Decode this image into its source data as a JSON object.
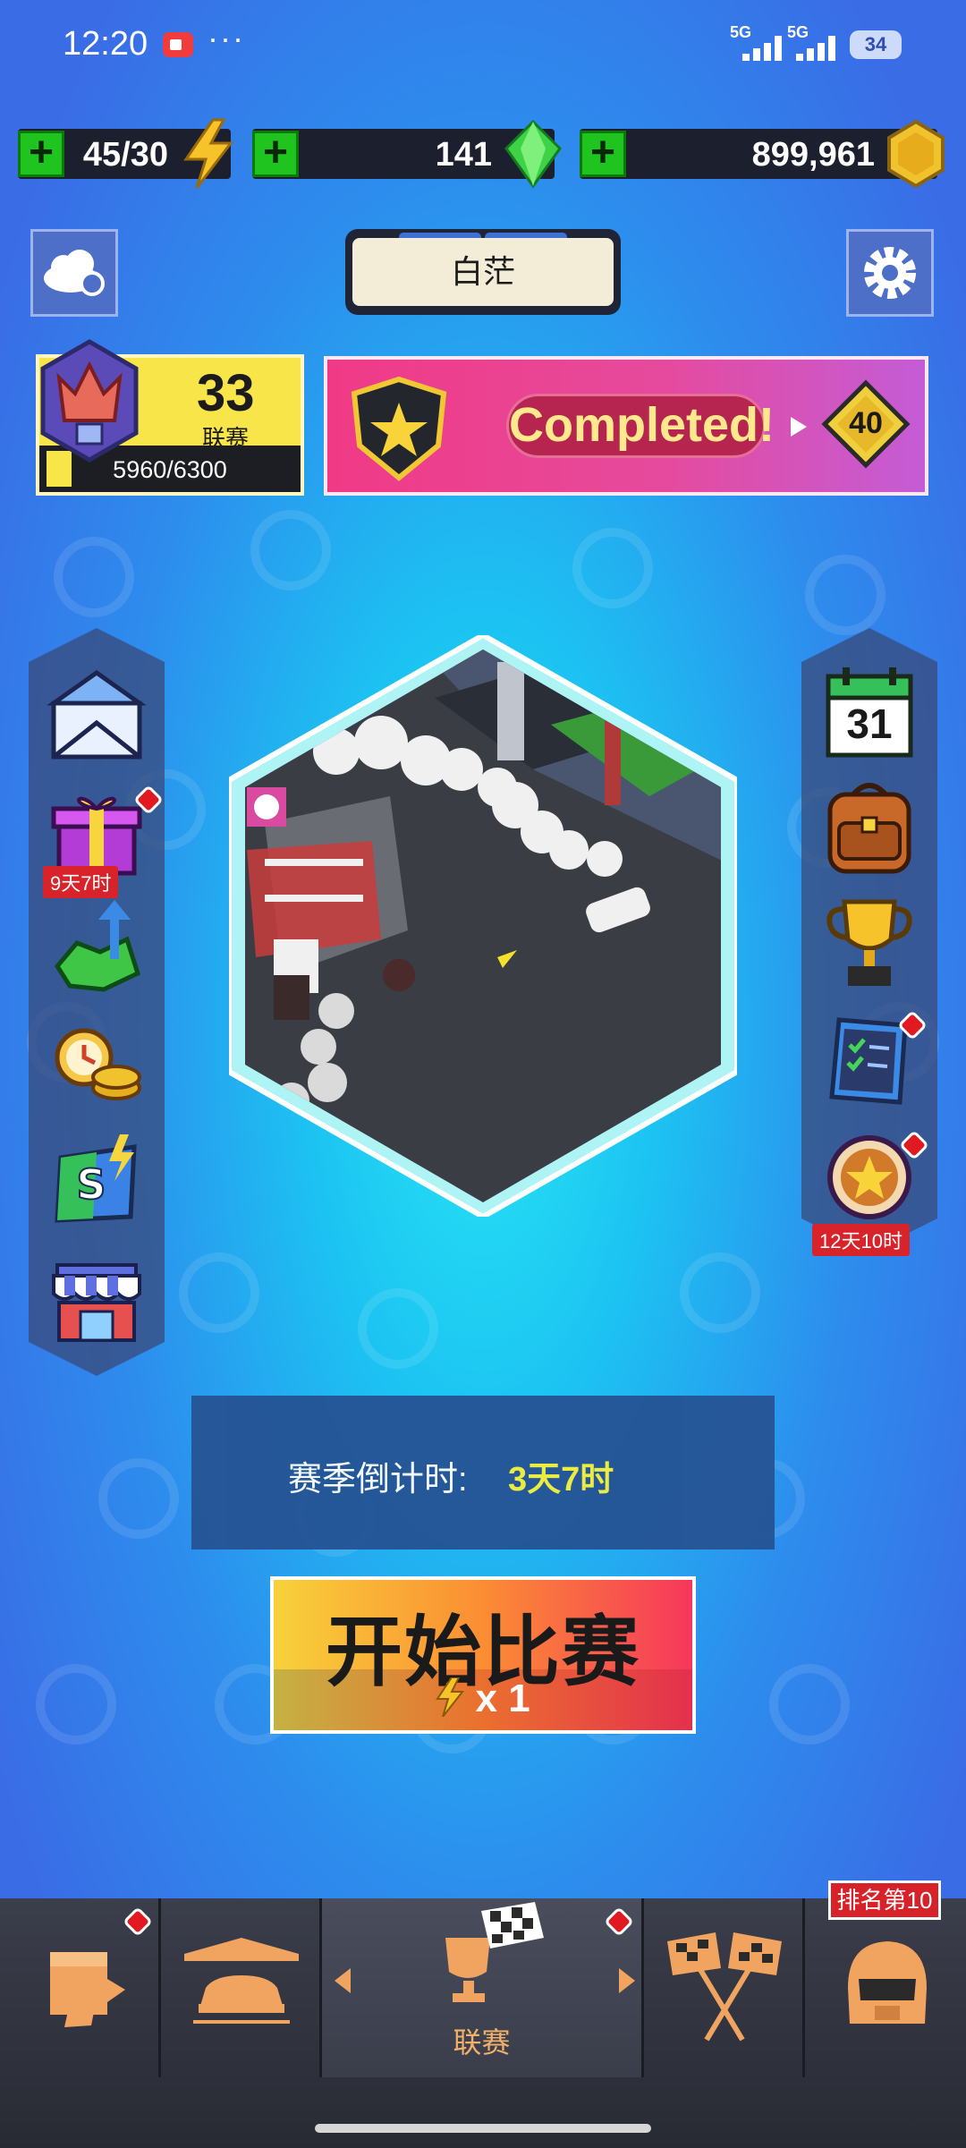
{
  "status_bar": {
    "time": "12:20",
    "more": "···",
    "network1": "5G",
    "network2": "5G",
    "battery": "34"
  },
  "currencies": {
    "energy": {
      "value": "45/30",
      "icon": "lightning-icon"
    },
    "gems": {
      "value": "141",
      "icon": "green-gem-icon"
    },
    "coins": {
      "value": "899,961",
      "icon": "gold-coin-icon"
    }
  },
  "header": {
    "player_name": "白茫"
  },
  "league": {
    "number": "33",
    "label": "联赛",
    "progress_text": "5960/6300",
    "progress": 0.946
  },
  "banner": {
    "text": "Completed!",
    "reward": "40"
  },
  "left_menu": {
    "items": [
      "mail-icon",
      "gift-icon",
      "gem-upgrade-icon",
      "time-coins-icon",
      "s-card-icon",
      "shop-icon"
    ],
    "gift_timer": "9天7时"
  },
  "right_menu": {
    "items": [
      "calendar-icon",
      "backpack-icon",
      "trophy-icon",
      "checklist-icon",
      "star-medal-icon"
    ],
    "calendar_day": "31",
    "medal_timer": "12天10时"
  },
  "season": {
    "label": "赛季倒计时:",
    "value": "3天7时"
  },
  "start_button": {
    "label": "开始比赛",
    "cost": "x 1"
  },
  "bottom_nav": {
    "active_label": "联赛",
    "rank_tag": "排名第10"
  },
  "colors": {
    "accent_yellow": "#f8e549",
    "green_plus": "#1fc41f",
    "badge_red": "#e11a21"
  }
}
